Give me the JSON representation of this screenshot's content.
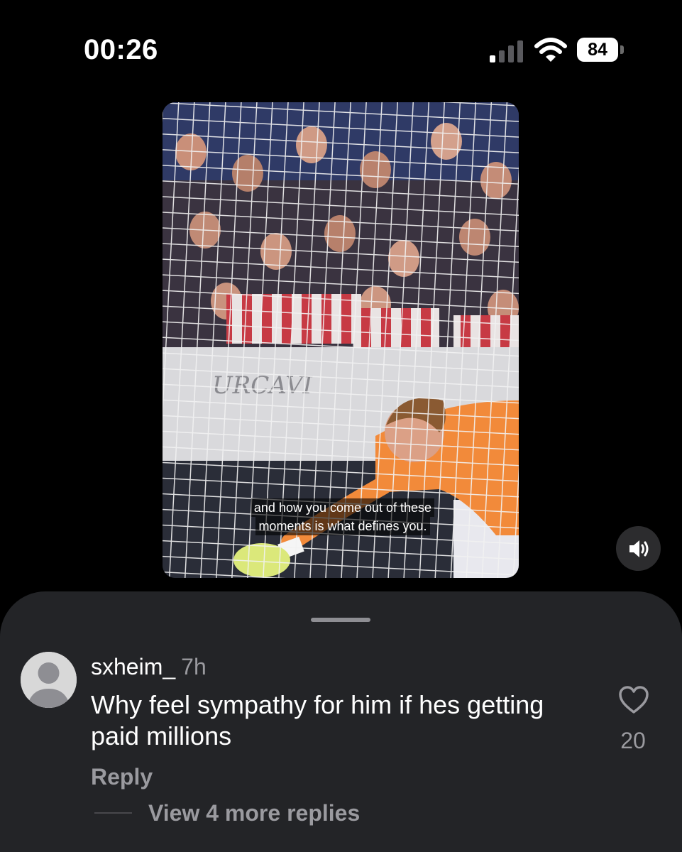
{
  "status_bar": {
    "time": "00:26",
    "battery": "84",
    "icons": [
      "cellular-signal-icon",
      "wifi-icon",
      "battery-icon"
    ]
  },
  "video": {
    "caption_lines": [
      "and how you come out of these",
      "moments is what defines you."
    ],
    "mute_icon": "speaker-icon"
  },
  "comment": {
    "username": "sxheim_",
    "time": "7h",
    "text": "Why feel sympathy for him if hes getting paid millions",
    "reply_label": "Reply",
    "like_count": "20",
    "view_replies_label": "View 4 more replies",
    "like_icon": "heart-outline-icon"
  },
  "colors": {
    "sheet_background": "#232427",
    "secondary_text": "#9a9a9f",
    "keeper_kit": "#f28a3a"
  }
}
